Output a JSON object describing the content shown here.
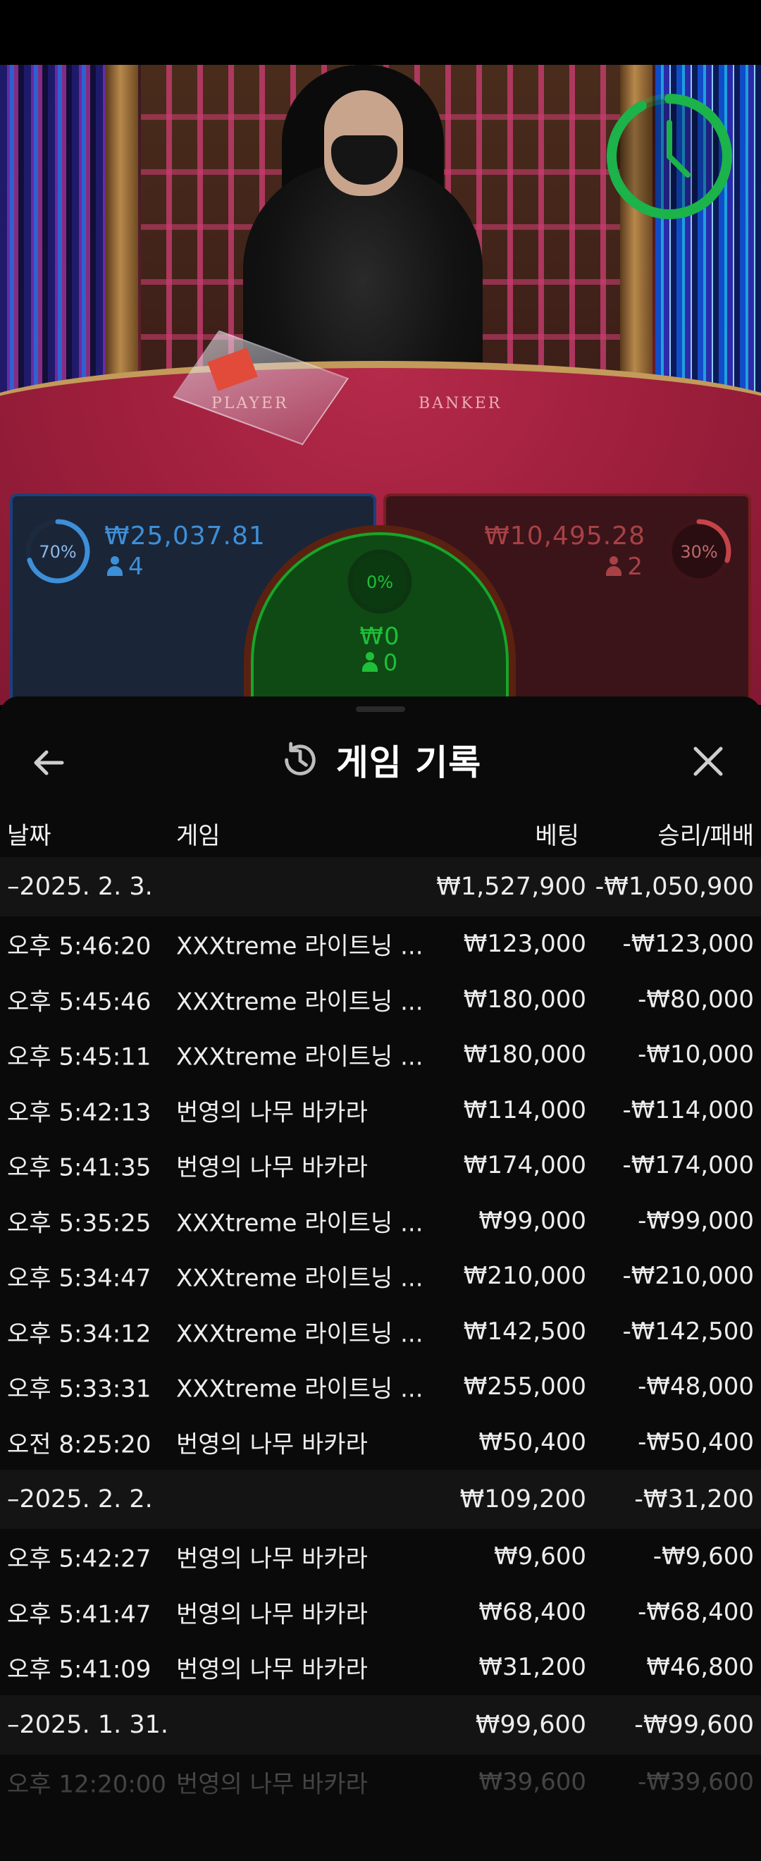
{
  "game_area": {
    "table_labels": {
      "player": "PLAYER",
      "banker": "BANKER"
    },
    "bets": {
      "player": {
        "percent": "70%",
        "percent_value": 0.7,
        "amount": "₩25,037.81",
        "count": "4",
        "color": "#3d8fd8"
      },
      "tie": {
        "percent": "0%",
        "percent_value": 0.0,
        "amount": "₩0",
        "count": "0",
        "color": "#1fbf3a"
      },
      "banker": {
        "percent": "30%",
        "percent_value": 0.3,
        "amount": "₩10,495.28",
        "count": "2",
        "color": "#c4444a"
      }
    },
    "timer": {
      "icon": "clock-icon",
      "remaining_fraction": 0.92,
      "color": "#1bb34a"
    }
  },
  "history": {
    "title": "게임 기록",
    "icons": {
      "back": "arrow-left-icon",
      "title": "history-icon",
      "close": "close-icon"
    },
    "columns": {
      "date": "날짜",
      "game": "게임",
      "bet": "베팅",
      "result": "승리/패배"
    },
    "rows": [
      {
        "type": "group",
        "date": "–2025. 2. 3.",
        "game": "",
        "bet": "₩1,527,900",
        "result": "-₩1,050,900"
      },
      {
        "type": "item",
        "date": "오후 5:46:20",
        "game": "XXXtreme 라이트닝 ...",
        "bet": "₩123,000",
        "result": "-₩123,000"
      },
      {
        "type": "item",
        "date": "오후 5:45:46",
        "game": "XXXtreme 라이트닝 ...",
        "bet": "₩180,000",
        "result": "-₩80,000"
      },
      {
        "type": "item",
        "date": "오후 5:45:11",
        "game": "XXXtreme 라이트닝 ...",
        "bet": "₩180,000",
        "result": "-₩10,000"
      },
      {
        "type": "item",
        "date": "오후 5:42:13",
        "game": "번영의 나무 바카라",
        "bet": "₩114,000",
        "result": "-₩114,000"
      },
      {
        "type": "item",
        "date": "오후 5:41:35",
        "game": "번영의 나무 바카라",
        "bet": "₩174,000",
        "result": "-₩174,000"
      },
      {
        "type": "item",
        "date": "오후 5:35:25",
        "game": "XXXtreme 라이트닝 ...",
        "bet": "₩99,000",
        "result": "-₩99,000"
      },
      {
        "type": "item",
        "date": "오후 5:34:47",
        "game": "XXXtreme 라이트닝 ...",
        "bet": "₩210,000",
        "result": "-₩210,000"
      },
      {
        "type": "item",
        "date": "오후 5:34:12",
        "game": "XXXtreme 라이트닝 ...",
        "bet": "₩142,500",
        "result": "-₩142,500"
      },
      {
        "type": "item",
        "date": "오후 5:33:31",
        "game": "XXXtreme 라이트닝 ...",
        "bet": "₩255,000",
        "result": "-₩48,000"
      },
      {
        "type": "item",
        "date": "오전 8:25:20",
        "game": "번영의 나무 바카라",
        "bet": "₩50,400",
        "result": "-₩50,400"
      },
      {
        "type": "group",
        "date": "–2025. 2. 2.",
        "game": "",
        "bet": "₩109,200",
        "result": "-₩31,200"
      },
      {
        "type": "item",
        "date": "오후 5:42:27",
        "game": "번영의 나무 바카라",
        "bet": "₩9,600",
        "result": "-₩9,600"
      },
      {
        "type": "item",
        "date": "오후 5:41:47",
        "game": "번영의 나무 바카라",
        "bet": "₩68,400",
        "result": "-₩68,400"
      },
      {
        "type": "item",
        "date": "오후 5:41:09",
        "game": "번영의 나무 바카라",
        "bet": "₩31,200",
        "result": "₩46,800"
      },
      {
        "type": "group",
        "date": "–2025. 1. 31.",
        "game": "",
        "bet": "₩99,600",
        "result": "-₩99,600"
      },
      {
        "type": "item",
        "date": "오후 12:20:00",
        "game": "번영의 나무 바카라",
        "bet": "₩39,600",
        "result": "-₩39,600",
        "faded": true
      }
    ]
  }
}
